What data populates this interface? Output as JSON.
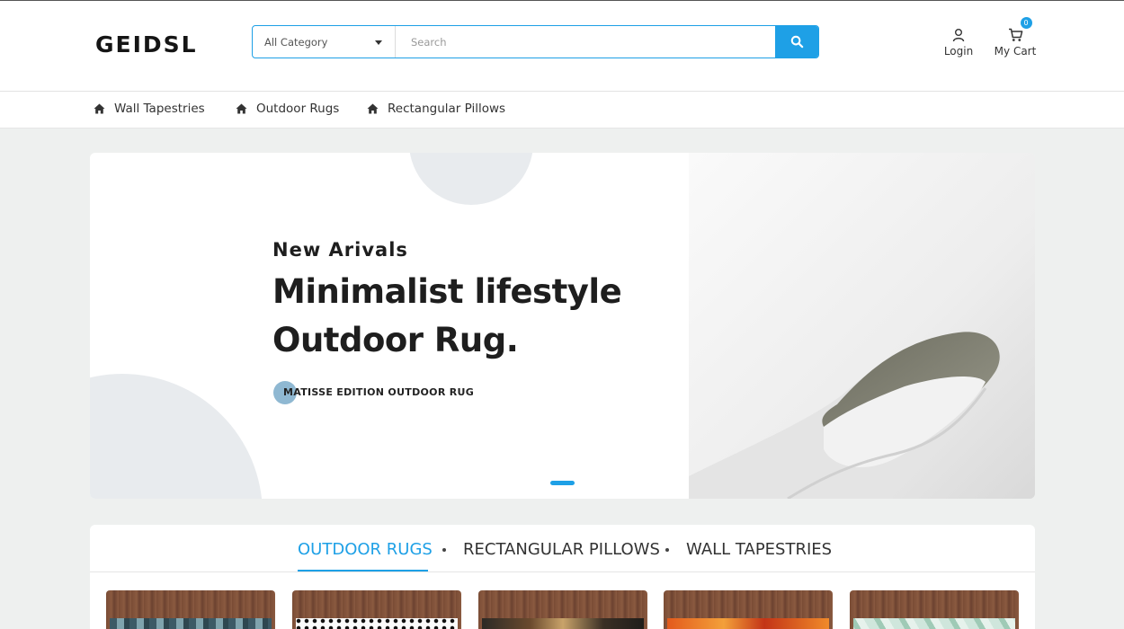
{
  "header": {
    "logo": "GEIDSL",
    "search": {
      "category": "All Category",
      "placeholder": "Search",
      "button_icon": "search-icon"
    },
    "login_label": "Login",
    "cart_label": "My Cart",
    "cart_count": "0"
  },
  "nav": {
    "items": [
      {
        "label": "Wall Tapestries",
        "icon": "home-icon"
      },
      {
        "label": "Outdoor Rugs",
        "icon": "home-icon"
      },
      {
        "label": "Rectangular Pillows",
        "icon": "home-icon"
      }
    ]
  },
  "hero": {
    "subtitle": "New Arivals",
    "title_line1": "Minimalist lifestyle",
    "title_line2": "Outdoor Rug.",
    "tagline": "MATISSE EDITION OUTDOOR RUG",
    "image": "rolled-white-rug-image"
  },
  "tabs": {
    "items": [
      {
        "label": "OUTDOOR RUGS",
        "active": true
      },
      {
        "label": "RECTANGULAR PILLOWS",
        "active": false
      },
      {
        "label": "WALL TAPESTRIES",
        "active": false
      }
    ]
  },
  "colors": {
    "accent": "#1ea0e6",
    "background": "#eef0ef",
    "text": "#1e1e1e"
  }
}
